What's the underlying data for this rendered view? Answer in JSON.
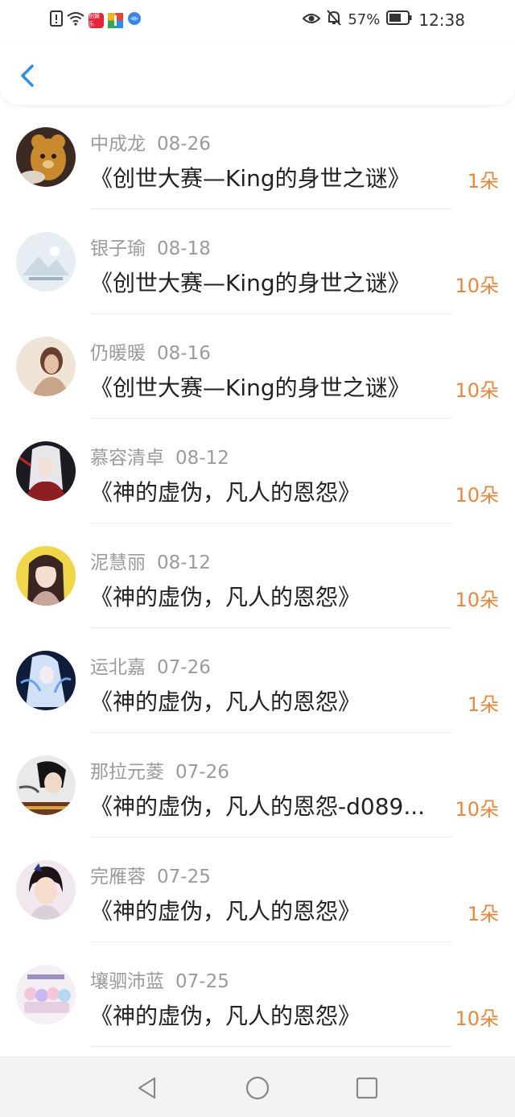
{
  "status_bar": {
    "icons": [
      "alert-icon",
      "wifi-icon",
      "app-icon-red",
      "app-icon-multicolor",
      "app-icon-blue",
      "eye-icon",
      "bell-off-icon",
      "battery-icon"
    ],
    "battery": "57%",
    "time": "12:38",
    "app_red_label": "创娱乐"
  },
  "header": {
    "back_icon": "chevron-left-icon",
    "accent": "#2d8ee8"
  },
  "colors": {
    "amount": "#e8873f",
    "meta": "#9b9b9b",
    "title": "#222222"
  },
  "items": [
    {
      "name": "中成龙",
      "date": "08-26",
      "title": "《创世大赛—King的身世之谜》",
      "amount": "1朵"
    },
    {
      "name": "银子瑜",
      "date": "08-18",
      "title": "《创世大赛—King的身世之谜》",
      "amount": "10朵"
    },
    {
      "name": "仍暖暖",
      "date": "08-16",
      "title": "《创世大赛—King的身世之谜》",
      "amount": "10朵"
    },
    {
      "name": "慕容清卓",
      "date": "08-12",
      "title": "《神的虚伪，凡人的恩怨》",
      "amount": "10朵"
    },
    {
      "name": "泥慧丽",
      "date": "08-12",
      "title": "《神的虚伪，凡人的恩怨》",
      "amount": "10朵"
    },
    {
      "name": "运北嘉",
      "date": "07-26",
      "title": "《神的虚伪，凡人的恩怨》",
      "amount": "1朵"
    },
    {
      "name": "那拉元菱",
      "date": "07-26",
      "title": "《神的虚伪，凡人的恩怨-d089...",
      "amount": "10朵"
    },
    {
      "name": "完雁蓉",
      "date": "07-25",
      "title": "《神的虚伪，凡人的恩怨》",
      "amount": "1朵"
    },
    {
      "name": "壤驷沛蓝",
      "date": "07-25",
      "title": "《神的虚伪，凡人的恩怨》",
      "amount": "10朵"
    }
  ],
  "nav_bar": {
    "icons": [
      "back-triangle-icon",
      "home-circle-icon",
      "recents-square-icon"
    ]
  }
}
